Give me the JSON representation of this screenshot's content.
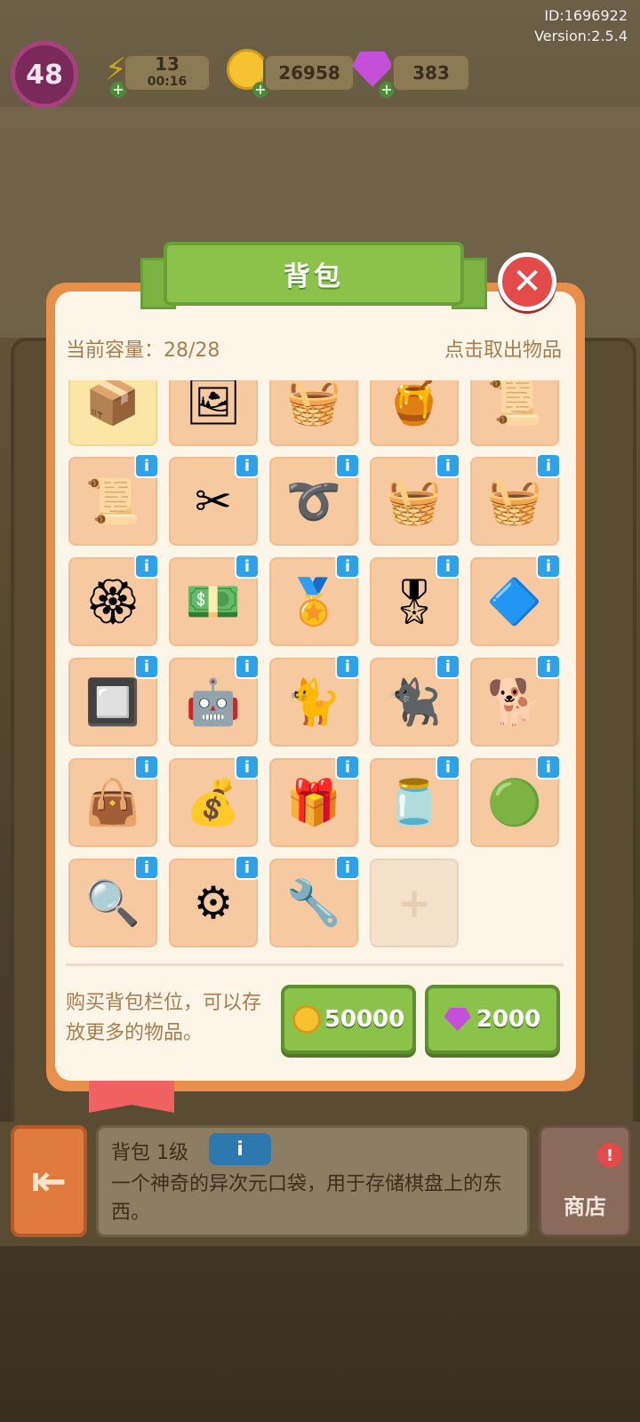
{
  "header": {
    "player_id": "ID:1696922",
    "version": "Version:2.5.4"
  },
  "resources": {
    "level": "48",
    "energy": "13",
    "energy_timer": "00:16",
    "coins": "26958",
    "gems": "383"
  },
  "backpack": {
    "title": "背包",
    "capacity_label": "当前容量：28/28",
    "take_out_hint": "点击取出物品",
    "items": [
      {
        "icon": "box-icon",
        "glyph": "📦",
        "info": false,
        "selected": true
      },
      {
        "icon": "frame-icon",
        "glyph": "🖼",
        "info": false
      },
      {
        "icon": "basket-icon",
        "glyph": "🧺",
        "info": false
      },
      {
        "icon": "pot-icon",
        "glyph": "🍯",
        "info": false
      },
      {
        "icon": "scroll-icon",
        "glyph": "📜",
        "info": false
      },
      {
        "icon": "scroll-icon",
        "glyph": "📜",
        "info": true
      },
      {
        "icon": "cloth-scissors-icon",
        "glyph": "✂",
        "info": true
      },
      {
        "icon": "rattan-icon",
        "glyph": "➰",
        "info": true
      },
      {
        "icon": "woven-basket-icon",
        "glyph": "🧺",
        "info": true
      },
      {
        "icon": "handle-basket-icon",
        "glyph": "🧺",
        "info": true
      },
      {
        "icon": "award-rosette-icon",
        "glyph": "🏵",
        "info": true
      },
      {
        "icon": "cash-stack-icon",
        "glyph": "💵",
        "info": true
      },
      {
        "icon": "medal-icon",
        "glyph": "🏅",
        "info": true
      },
      {
        "icon": "crown-medal-icon",
        "glyph": "🎖",
        "info": true
      },
      {
        "icon": "chip-icon",
        "glyph": "🔷",
        "info": true
      },
      {
        "icon": "circuit-board-icon",
        "glyph": "🔲",
        "info": true
      },
      {
        "icon": "robot-vacuum-icon",
        "glyph": "🤖",
        "info": true
      },
      {
        "icon": "sleeping-cat-icon",
        "glyph": "🐈",
        "info": true
      },
      {
        "icon": "black-cat-icon",
        "glyph": "🐈‍⬛",
        "info": true
      },
      {
        "icon": "shiba-icon",
        "glyph": "🐕",
        "info": true
      },
      {
        "icon": "handbag-icon",
        "glyph": "👜",
        "info": true
      },
      {
        "icon": "coin-sack-icon",
        "glyph": "💰",
        "info": true
      },
      {
        "icon": "gift-box-icon",
        "glyph": "🎁",
        "info": true
      },
      {
        "icon": "gem-jar-icon",
        "glyph": "🫙",
        "info": true
      },
      {
        "icon": "green-ball-icon",
        "glyph": "🟢",
        "info": true
      },
      {
        "icon": "magnifier-gadget-icon",
        "glyph": "🔍",
        "info": true
      },
      {
        "icon": "orange-machine-icon",
        "glyph": "⚙",
        "info": true
      },
      {
        "icon": "orange-device-icon",
        "glyph": "🔧",
        "info": true
      },
      {
        "icon": "add-slot-icon",
        "glyph": "+",
        "info": false,
        "empty": true
      }
    ],
    "buy_text": "购买背包栏位，可以存放更多的物品。",
    "buy_coin_price": "50000",
    "buy_gem_price": "2000"
  },
  "detail": {
    "title": "背包 1级",
    "info_label": "i",
    "description": "一个神奇的异次元口袋，用于存储棋盘上的东西。"
  },
  "nav": {
    "shop_label": "商店",
    "shop_badge": "!"
  },
  "colors": {
    "accent_green": "#8bc34a",
    "panel_cream": "#fdf6e8",
    "cell_peach": "#f6c9a0",
    "info_blue": "#2ea2e8",
    "close_red": "#e34a4a"
  }
}
